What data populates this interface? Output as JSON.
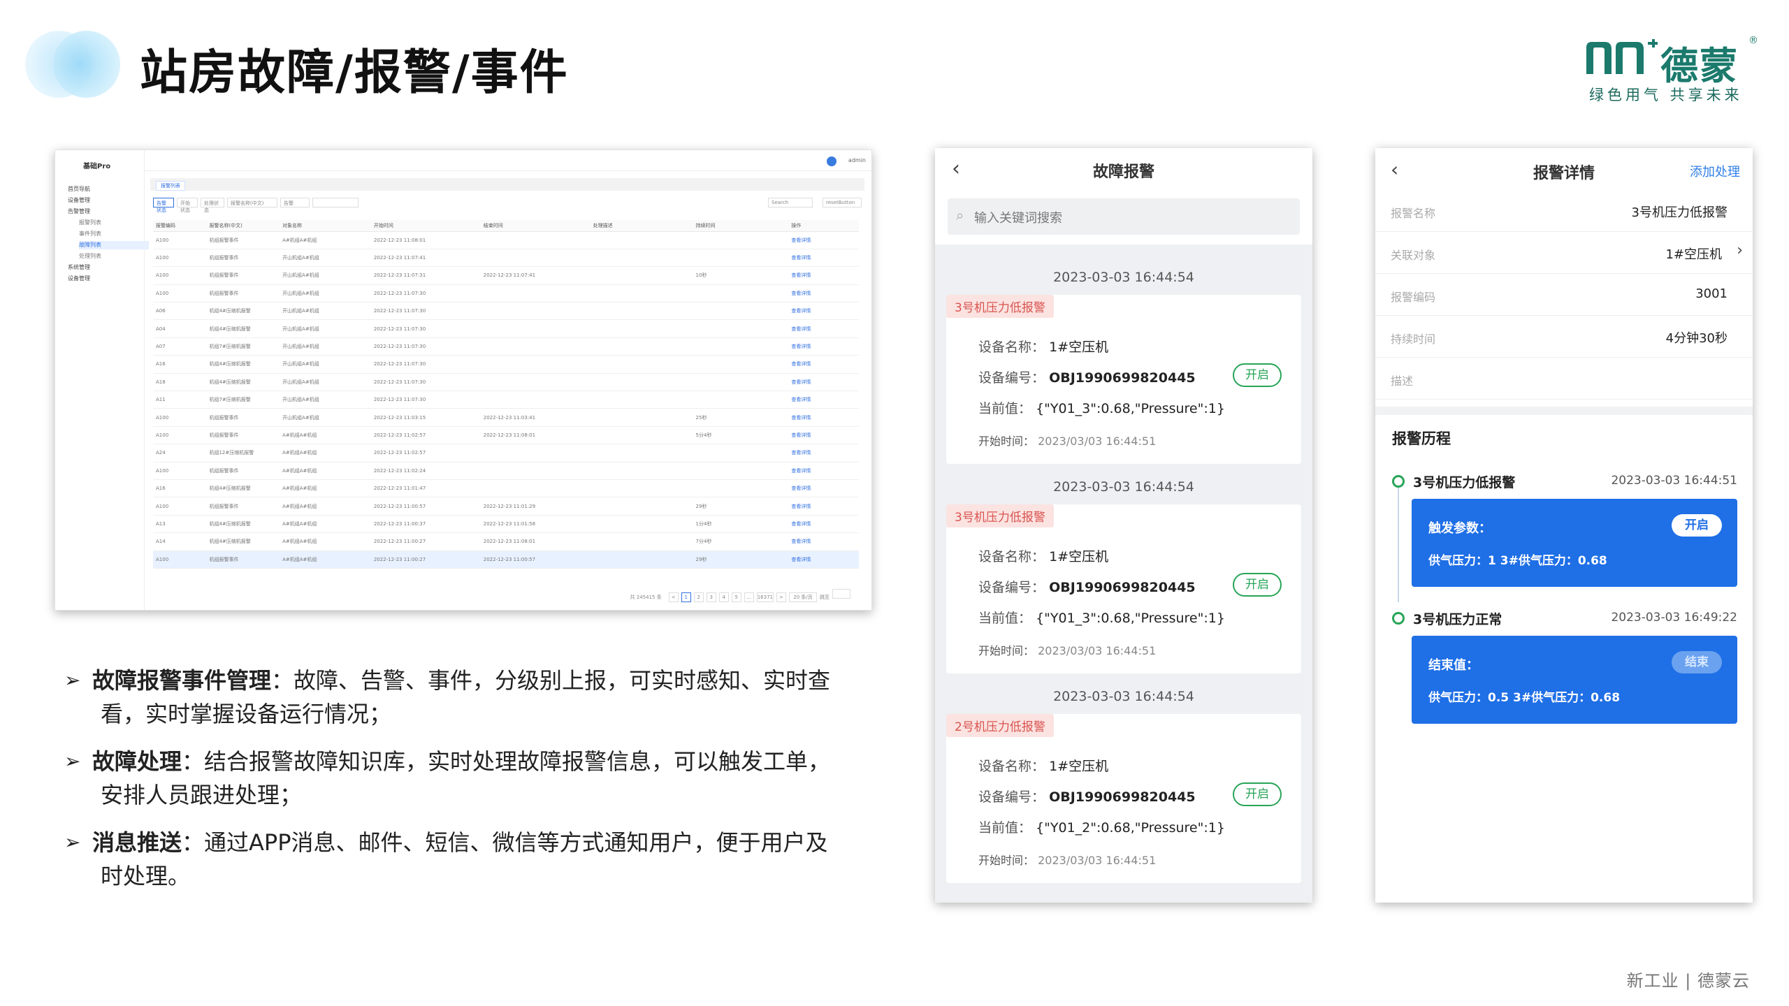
{
  "header": {
    "title": "站房故障/报警/事件",
    "brand_name": "德蒙",
    "brand_reg": "®",
    "slogan": "绿色用气 共享未来"
  },
  "admin_screenshot": {
    "brand": "基础Pro",
    "user": "admin",
    "sidebar": [
      {
        "label": "首页导航",
        "sub": false,
        "active": false
      },
      {
        "label": "设备管理",
        "sub": false,
        "active": false
      },
      {
        "label": "告警管理",
        "sub": false,
        "active": true
      },
      {
        "label": "报警列表",
        "sub": true,
        "active": false
      },
      {
        "label": "事件列表",
        "sub": true,
        "active": false
      },
      {
        "label": "故障列表",
        "sub": true,
        "active": true
      },
      {
        "label": "处理列表",
        "sub": true,
        "active": false
      },
      {
        "label": "系统管理",
        "sub": false,
        "active": false
      },
      {
        "label": "设备管理",
        "sub": false,
        "active": false
      }
    ],
    "tab": "报警列表",
    "filters": [
      "告警状态",
      "开始状态",
      "处理状态",
      "报警名称(中文)",
      "告警",
      "",
      "Search",
      "resetButton"
    ],
    "columns": [
      "报警编码",
      "报警名称(中文)",
      "对象名称",
      "开始时间",
      "结束时间",
      "处理描述",
      "持续时间",
      "操作"
    ],
    "rows": [
      [
        "A100",
        "机组报警事件",
        "A#机组A#机组",
        "2022-12-23 11:08:01",
        "",
        "",
        "",
        "查看详情"
      ],
      [
        "A100",
        "机组报警事件",
        "开山机组A#机组",
        "2022-12-23 11:07:41",
        "",
        "",
        "",
        "查看详情"
      ],
      [
        "A100",
        "机组报警事件",
        "开山机组A#机组",
        "2022-12-23 11:07:31",
        "2022-12-23 11:07:41",
        "",
        "10秒",
        "查看详情"
      ],
      [
        "A100",
        "机组报警事件",
        "开山机组A#机组",
        "2022-12-23 11:07:30",
        "",
        "",
        "",
        "查看详情"
      ],
      [
        "A06",
        "机组4#压缩机报警",
        "开山机组A#机组",
        "2022-12-23 11:07:30",
        "",
        "",
        "",
        "查看详情"
      ],
      [
        "A04",
        "机组4#压缩机报警",
        "开山机组A#机组",
        "2022-12-23 11:07:30",
        "",
        "",
        "",
        "查看详情"
      ],
      [
        "A07",
        "机组7#压缩机报警",
        "开山机组A#机组",
        "2022-12-23 11:07:30",
        "",
        "",
        "",
        "查看详情"
      ],
      [
        "A16",
        "机组4#压缩机报警",
        "开山机组A#机组",
        "2022-12-23 11:07:30",
        "",
        "",
        "",
        "查看详情"
      ],
      [
        "A18",
        "机组4#压缩机报警",
        "开山机组A#机组",
        "2022-12-23 11:07:30",
        "",
        "",
        "",
        "查看详情"
      ],
      [
        "A11",
        "机组7#压缩机报警",
        "开山机组A#机组",
        "2022-12-23 11:07:30",
        "",
        "",
        "",
        "查看详情"
      ],
      [
        "A100",
        "机组报警事件",
        "开山机组A#机组",
        "2022-12-23 11:03:15",
        "2022-12-23 11:03:41",
        "",
        "25秒",
        "查看详情"
      ],
      [
        "A100",
        "机组报警事件",
        "A#机组A#机组",
        "2022-12-23 11:02:57",
        "2022-12-23 11:08:01",
        "",
        "5分4秒",
        "查看详情"
      ],
      [
        "A24",
        "机组12#压缩机报警",
        "A#机组A#机组",
        "2022-12-23 11:02:57",
        "",
        "",
        "",
        "查看详情"
      ],
      [
        "A100",
        "机组报警事件",
        "A#机组A#机组",
        "2022-12-23 11:02:24",
        "",
        "",
        "",
        "查看详情"
      ],
      [
        "A16",
        "机组4#压缩机报警",
        "A#机组A#机组",
        "2022-12-23 11:01:47",
        "",
        "",
        "",
        "查看详情"
      ],
      [
        "A100",
        "机组报警事件",
        "A#机组A#机组",
        "2022-12-23 11:00:57",
        "2022-12-23 11:01:29",
        "",
        "29秒",
        "查看详情"
      ],
      [
        "A13",
        "机组4#压缩机报警",
        "A#机组A#机组",
        "2022-12-23 11:00:37",
        "2022-12-23 11:01:58",
        "",
        "1分4秒",
        "查看详情"
      ],
      [
        "A14",
        "机组4#压缩机报警",
        "A#机组A#机组",
        "2022-12-23 11:00:27",
        "2022-12-23 11:08:01",
        "",
        "7分4秒",
        "查看详情"
      ],
      [
        "A100",
        "机组报警事件",
        "A#机组A#机组",
        "2022-12-23 11:00:27",
        "2022-12-23 11:00:57",
        "",
        "29秒",
        "查看详情"
      ]
    ],
    "pager": {
      "total": "共 245415 条",
      "pages": [
        "<",
        "1",
        "2",
        "3",
        "4",
        "5",
        "…",
        "16371",
        ">"
      ],
      "size": "20 条/页",
      "goto": "跳至"
    }
  },
  "bullets": [
    {
      "title": "故障报警事件管理",
      "text_line1": "：故障、告警、事件，分级别上报，可实时感知、实时查",
      "text_line2": "看，实时掌握设备运行情况；"
    },
    {
      "title": "故障处理",
      "text_line1": "：结合报警故障知识库，实时处理故障报警信息，可以触发工单，",
      "text_line2": "安排人员跟进处理；"
    },
    {
      "title": "消息推送",
      "text_line1": "：通过APP消息、邮件、短信、微信等方式通知用户，便于用户及",
      "text_line2": "时处理。"
    }
  ],
  "phone_alarms": {
    "title": "故障报警",
    "back": "‹",
    "search_placeholder": "输入关键词搜索",
    "labels": {
      "device_name": "设备名称：",
      "device_code": "设备编号：",
      "current": "当前值：",
      "start": "开始时间："
    },
    "open_label": "开启",
    "groups": [
      {
        "time": "2023-03-03 16:44:54",
        "tag": "3号机压力低报警",
        "device_name": "1#空压机",
        "device_code": "OBJ1990699820445",
        "current": "{\"Y01_3\":0.68,\"Pressure\":1}",
        "start": "2023/03/03 16:44:51"
      },
      {
        "time": "2023-03-03 16:44:54",
        "tag": "3号机压力低报警",
        "device_name": "1#空压机",
        "device_code": "OBJ1990699820445",
        "current": "{\"Y01_3\":0.68,\"Pressure\":1}",
        "start": "2023/03/03 16:44:51"
      },
      {
        "time": "2023-03-03 16:44:54",
        "tag": "2号机压力低报警",
        "device_name": "1#空压机",
        "device_code": "OBJ1990699820445",
        "current": "{\"Y01_2\":0.68,\"Pressure\":1}",
        "start": "2023/03/03 16:44:51"
      }
    ]
  },
  "phone_detail": {
    "title": "报警详情",
    "back": "‹",
    "action": "添加处理",
    "fields": [
      {
        "k": "报警名称",
        "v": "3号机压力低报警",
        "chevron": false
      },
      {
        "k": "关联对象",
        "v": "1#空压机",
        "chevron": true
      },
      {
        "k": "报警编码",
        "v": "3001",
        "chevron": false
      },
      {
        "k": "持续时间",
        "v": "4分钟30秒",
        "chevron": false
      },
      {
        "k": "描述",
        "v": "",
        "chevron": false
      }
    ],
    "history_title": "报警历程",
    "events": [
      {
        "name": "3号机压力低报警",
        "time": "2023-03-03 16:44:51",
        "box_label": "触发参数：",
        "box_text": "供气压力：1   3#供气压力：0.68",
        "button": "开启",
        "dim": false
      },
      {
        "name": "3号机压力正常",
        "time": "2023-03-03 16:49:22",
        "box_label": "结束值：",
        "box_text": "供气压力：0.5   3#供气压力：0.68",
        "button": "结束",
        "dim": true
      }
    ]
  },
  "footer": "新工业 | 德蒙云",
  "colors": {
    "brand_green": "#1b7a6c",
    "accent_blue": "#1f6fe6",
    "alarm_red": "#d9534f",
    "open_green": "#27a457"
  }
}
